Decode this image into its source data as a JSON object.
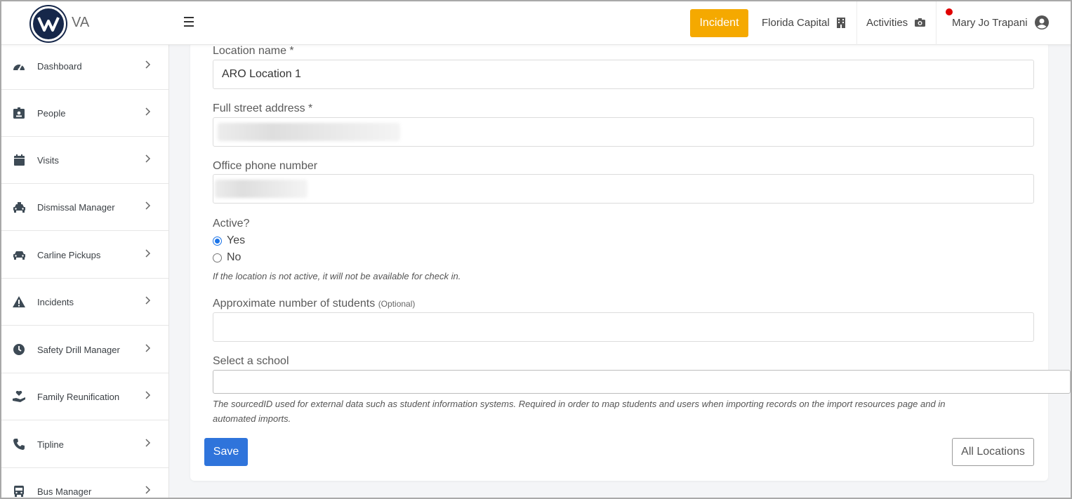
{
  "header": {
    "brand": "VA",
    "incident_button": "Incident",
    "school": "Florida Capital",
    "activities": "Activities",
    "user": "Mary Jo Trapani",
    "colors": {
      "incident": "#f5a900",
      "notification": "#e00000",
      "logo": "#16274a"
    }
  },
  "sidebar": {
    "items": [
      {
        "label": "Dashboard",
        "icon": "tachometer-icon"
      },
      {
        "label": "People",
        "icon": "id-badge-icon"
      },
      {
        "label": "Visits",
        "icon": "calendar-icon"
      },
      {
        "label": "Dismissal Manager",
        "icon": "taxi-icon"
      },
      {
        "label": "Carline Pickups",
        "icon": "car-icon"
      },
      {
        "label": "Incidents",
        "icon": "warning-icon"
      },
      {
        "label": "Safety Drill Manager",
        "icon": "clock-icon"
      },
      {
        "label": "Family Reunification",
        "icon": "hand-heart-icon"
      },
      {
        "label": "Tipline",
        "icon": "phone-icon"
      },
      {
        "label": "Bus Manager",
        "icon": "bus-icon"
      }
    ]
  },
  "form": {
    "location_name": {
      "label": "Location name *",
      "value": "ARO Location 1"
    },
    "street_address": {
      "label": "Full street address *"
    },
    "office_phone": {
      "label": "Office phone number"
    },
    "active": {
      "label": "Active?",
      "options": [
        "Yes",
        "No"
      ],
      "selected": "Yes",
      "help": "If the location is not active, it will not be available for check in."
    },
    "students": {
      "label": "Approximate number of students",
      "optional": "(Optional)",
      "value": ""
    },
    "school": {
      "label": "Select a school",
      "value": "",
      "help_line1": "The sourcedID used for external data such as student information systems. Required in order to map students and users when importing records on the import resources page and in",
      "help_line2": "automated imports."
    },
    "save_button": "Save",
    "all_locations_button": "All Locations",
    "primary_color": "#2f74db"
  }
}
